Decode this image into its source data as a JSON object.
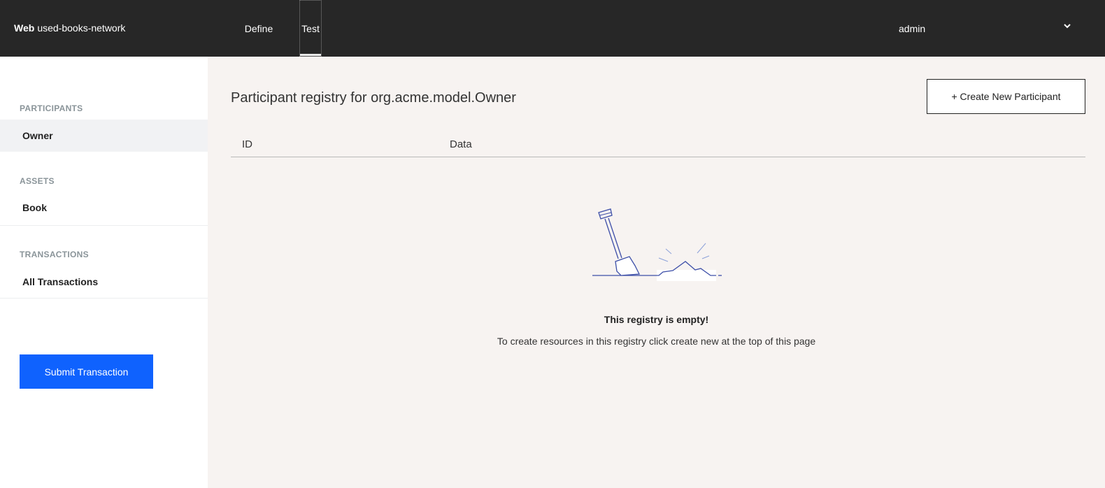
{
  "header": {
    "brand_bold": "Web",
    "brand_name": "used-books-network",
    "tabs": [
      {
        "label": "Define"
      },
      {
        "label": "Test"
      }
    ],
    "user": "admin",
    "user_menu_icon": "chevron-down-icon"
  },
  "sidebar": {
    "sections": [
      {
        "label": "PARTICIPANTS",
        "items": [
          {
            "label": "Owner",
            "active": true
          }
        ]
      },
      {
        "label": "ASSETS",
        "items": [
          {
            "label": "Book",
            "active": false
          }
        ]
      },
      {
        "label": "TRANSACTIONS",
        "items": [
          {
            "label": "All Transactions",
            "active": false
          }
        ]
      }
    ],
    "submit_label": "Submit Transaction"
  },
  "main": {
    "title": "Participant registry for org.acme.model.Owner",
    "create_label": "+ Create New Participant",
    "columns": [
      "ID",
      "Data"
    ],
    "empty": {
      "illustration": "shovel-digging-illustration",
      "title": "This registry is empty!",
      "description": "To create resources in this registry click create new at the top of this page"
    }
  },
  "colors": {
    "topbar": "#272727",
    "primary_button": "#0f62fe",
    "main_background": "#f7f3f1",
    "illustration": "#3d4fa8"
  }
}
